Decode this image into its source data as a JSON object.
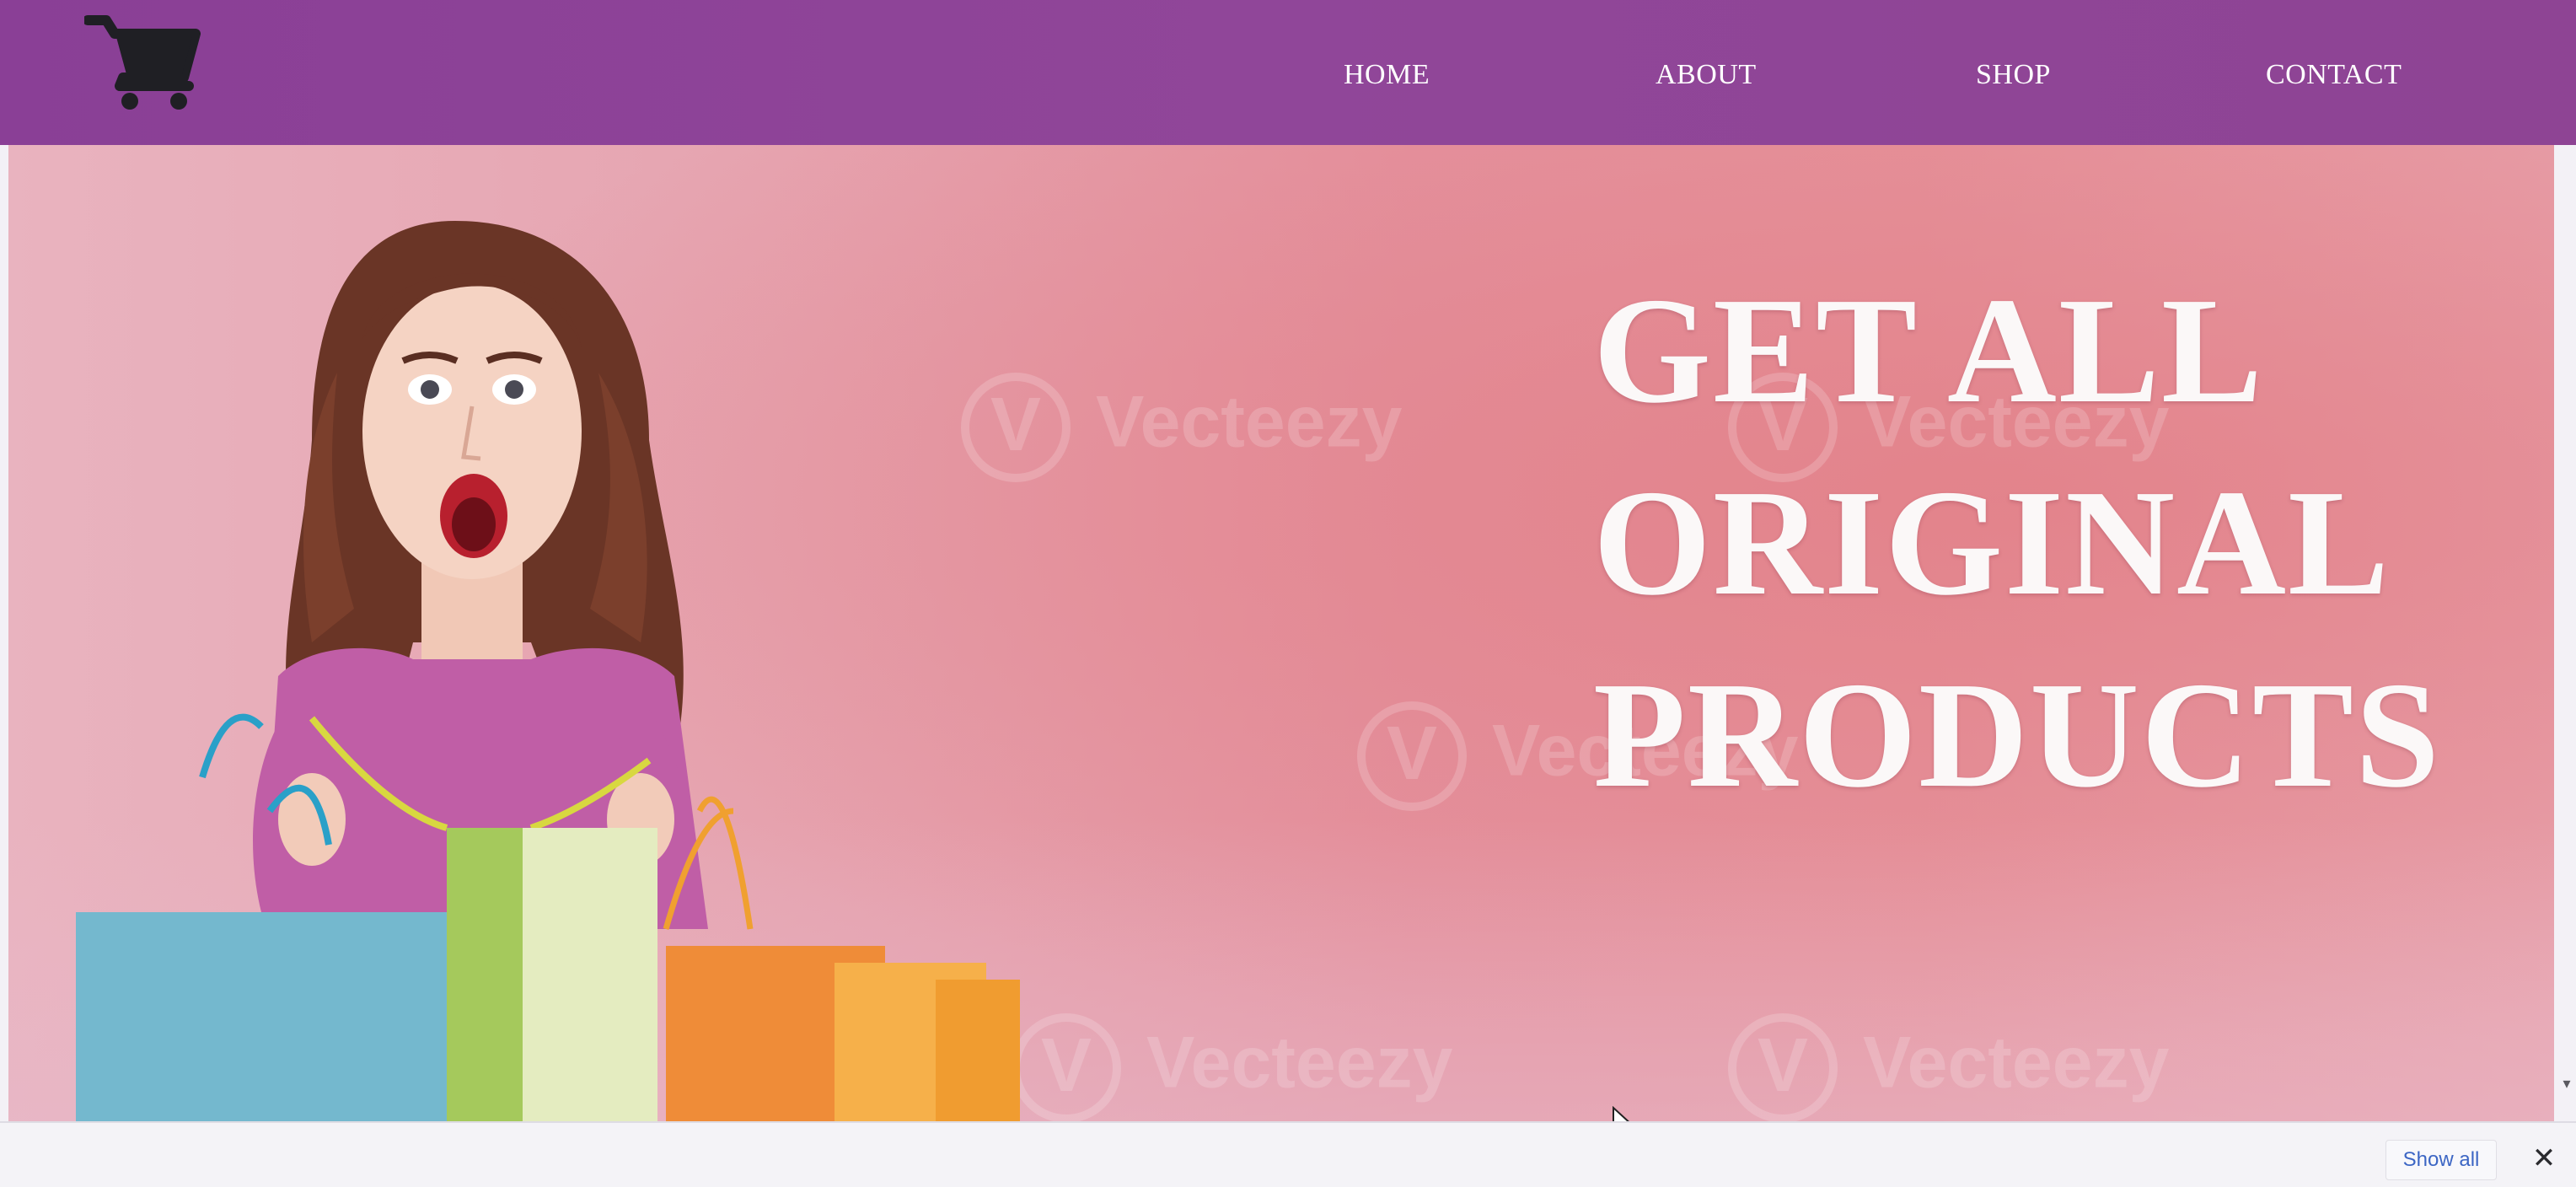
{
  "nav": {
    "logo_icon": "shopping-cart-icon",
    "items": [
      {
        "label": "HOME"
      },
      {
        "label": "ABOUT"
      },
      {
        "label": "SHOP"
      },
      {
        "label": "CONTACT"
      }
    ]
  },
  "hero": {
    "headline": [
      "GET ALL",
      "ORIGINAL",
      "PRODUCTS"
    ],
    "watermark_text": "Vecteezy",
    "image_description_icon": "woman-with-shopping-bags-image"
  },
  "notification_bar": {
    "show_all_label": "Show all",
    "close_label": "✕"
  },
  "colors": {
    "navbar": "#8e4494",
    "hero_pink": "#e493a0",
    "headline_text": "#fbf8f8",
    "link_blue": "#3c66c4"
  }
}
